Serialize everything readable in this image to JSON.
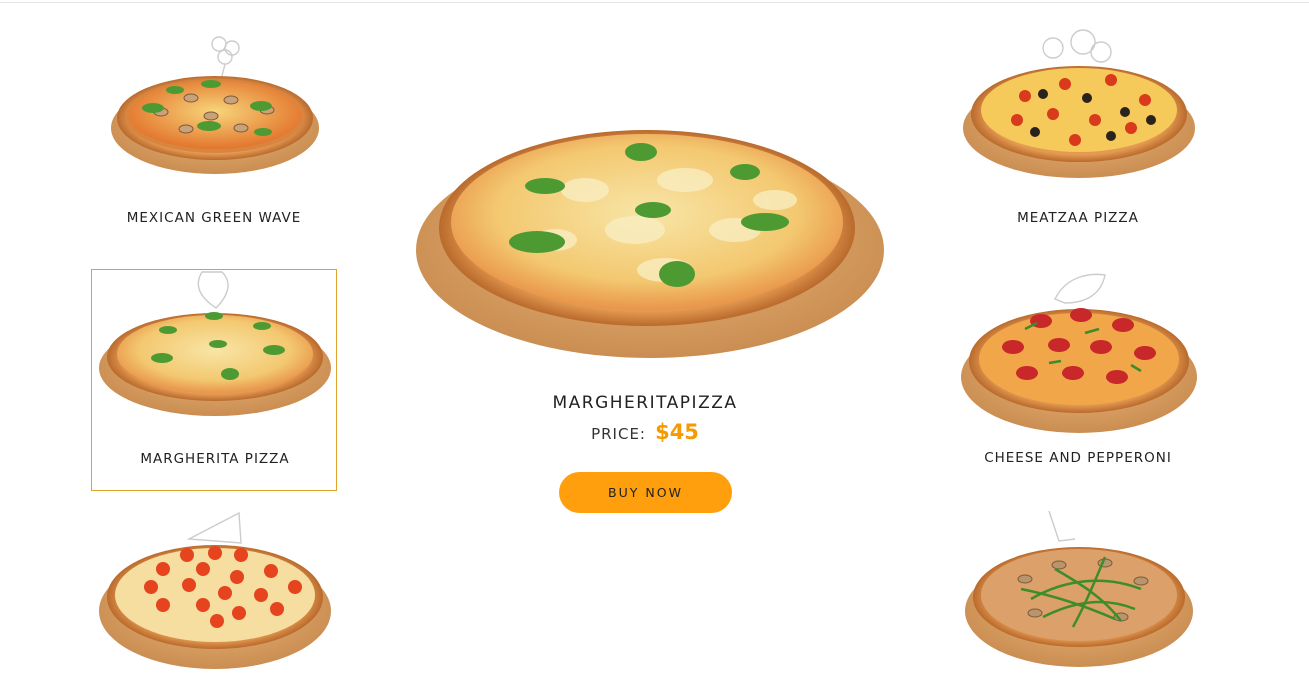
{
  "menu": {
    "left": [
      {
        "name": "MEXICAN GREEN WAVE"
      },
      {
        "name": "MARGHERITA PIZZA"
      },
      {
        "name": ""
      }
    ],
    "right": [
      {
        "name": "MEATZAA PIZZA"
      },
      {
        "name": "CHEESE AND PEPPERONI"
      },
      {
        "name": ""
      }
    ]
  },
  "featured": {
    "title": "MARGHERITAPIZZA",
    "price_label": "PRICE:",
    "price": "$45",
    "button": "BUY NOW"
  },
  "colors": {
    "accent": "#ff9f0d",
    "price": "#f59a00",
    "selected_border": "#e0a32a"
  }
}
